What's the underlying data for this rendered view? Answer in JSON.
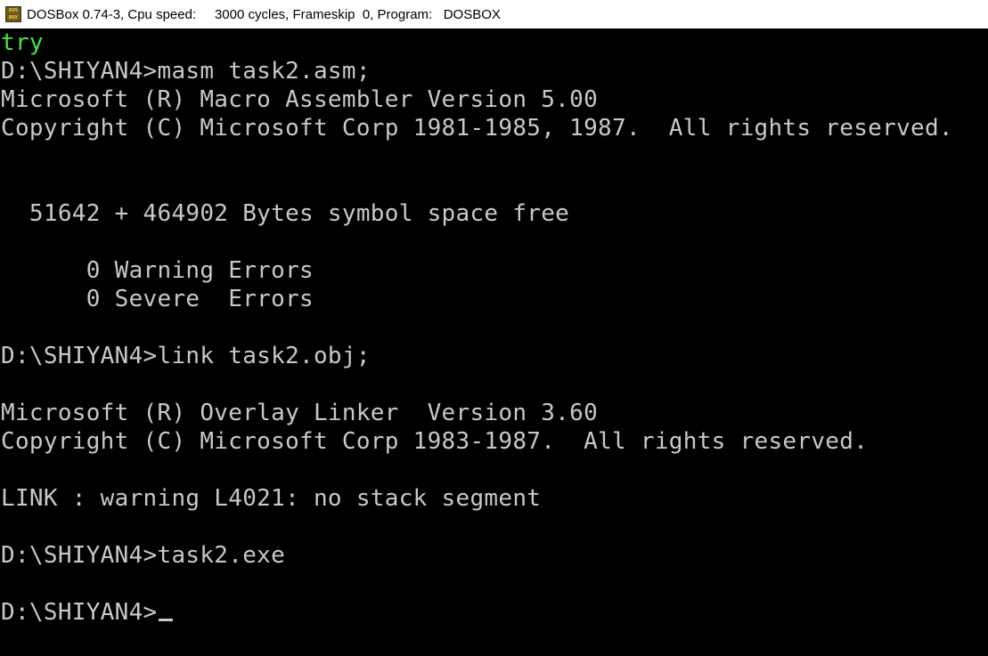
{
  "window": {
    "icon_text_top": "DOS",
    "icon_text_bottom": "BOX",
    "title": "DOSBox 0.74-3, Cpu speed:     3000 cycles, Frameskip  0, Program:   DOSBOX"
  },
  "console": {
    "lines": [
      "try",
      "D:\\SHIYAN4>masm task2.asm;",
      "Microsoft (R) Macro Assembler Version 5.00",
      "Copyright (C) Microsoft Corp 1981-1985, 1987.  All rights reserved.",
      "",
      "",
      "  51642 + 464902 Bytes symbol space free",
      "",
      "      0 Warning Errors",
      "      0 Severe  Errors",
      "",
      "D:\\SHIYAN4>link task2.obj;",
      "",
      "Microsoft (R) Overlay Linker  Version 3.60",
      "Copyright (C) Microsoft Corp 1983-1987.  All rights reserved.",
      "",
      "LINK : warning L4021: no stack segment",
      "",
      "D:\\SHIYAN4>task2.exe",
      "",
      "D:\\SHIYAN4>"
    ],
    "colors": {
      "text": "#c8c8c8",
      "highlight": "#4ee04e",
      "background": "#000000"
    }
  }
}
